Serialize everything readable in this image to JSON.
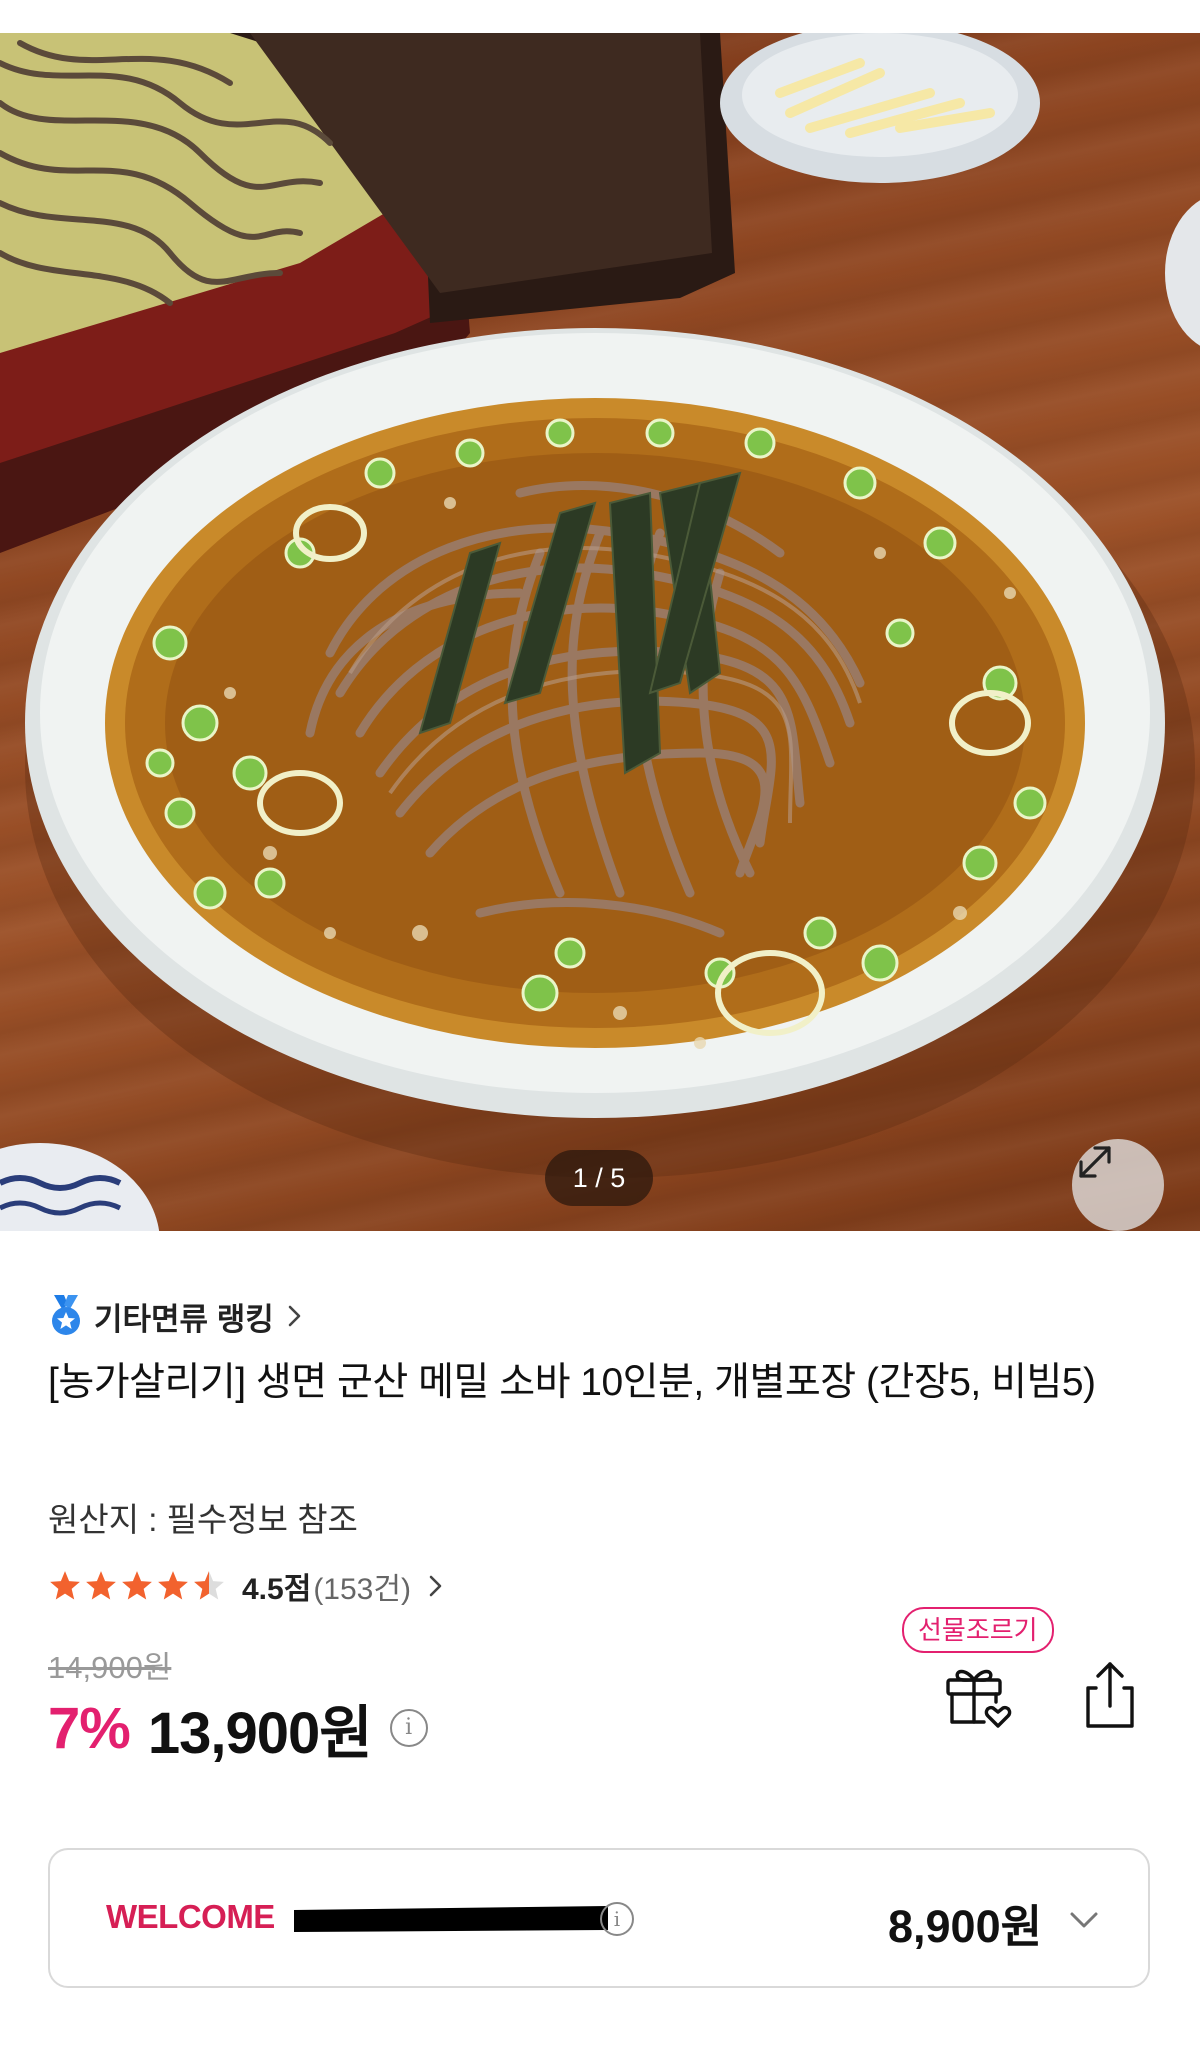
{
  "gallery": {
    "counter": "1 / 5",
    "image_alt": "메밀 소바",
    "expand_icon": "expand-arrows-icon"
  },
  "product": {
    "ranking_label": "기타면류 랭킹",
    "ranking_icon": "medal-icon",
    "title": "[농가살리기] 생면 군산 메밀 소바 10인분, 개별포장 (간장5, 비빔5)",
    "origin": "원산지 : 필수정보 참조",
    "rating": {
      "stars": 4.5,
      "max": 5,
      "score": "4.5점",
      "count": "(153건)"
    },
    "original_price": "14,900원",
    "discount": "7%",
    "price": "13,900원",
    "gift_badge": "선물조르기",
    "gift_icon": "gift-heart-icon",
    "share_icon": "share-icon"
  },
  "coupon": {
    "label": "WELCOME",
    "price": "8,900원",
    "chevron_icon": "chevron-down-icon"
  },
  "colors": {
    "accent": "#e3206f",
    "coupon_label": "#d61f55",
    "star": "#f2622e"
  }
}
